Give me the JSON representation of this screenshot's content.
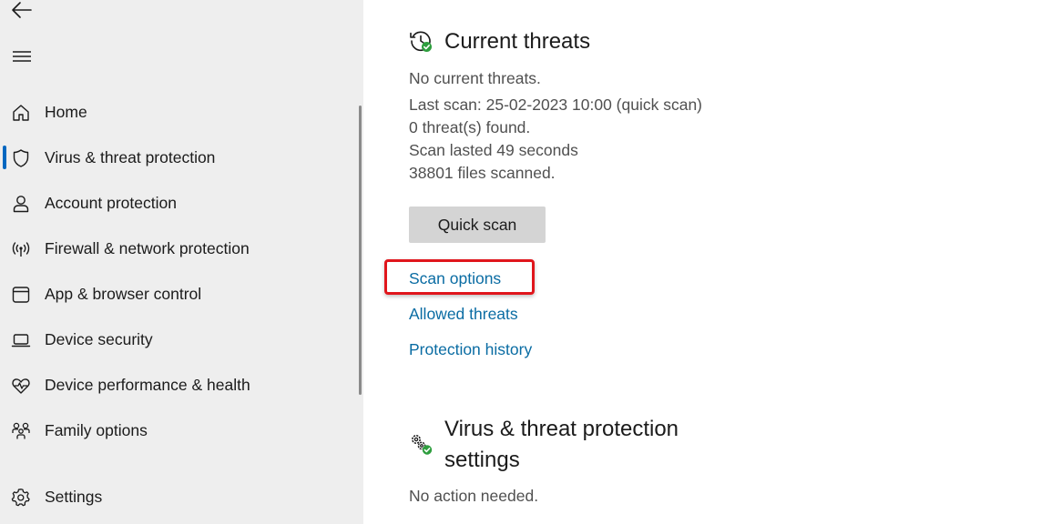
{
  "sidebar": {
    "items": [
      {
        "label": "Home",
        "icon": "home-icon"
      },
      {
        "label": "Virus & threat protection",
        "icon": "shield-icon",
        "active": true
      },
      {
        "label": "Account protection",
        "icon": "person-icon"
      },
      {
        "label": "Firewall & network protection",
        "icon": "antenna-icon"
      },
      {
        "label": "App & browser control",
        "icon": "browser-window-icon"
      },
      {
        "label": "Device security",
        "icon": "laptop-icon"
      },
      {
        "label": "Device performance & health",
        "icon": "heart-pulse-icon"
      },
      {
        "label": "Family options",
        "icon": "family-icon"
      },
      {
        "label": "Settings",
        "icon": "gear-icon"
      }
    ]
  },
  "current_threats": {
    "title": "Current threats",
    "status": "No current threats.",
    "last_scan": "Last scan: 25-02-2023 10:00 (quick scan)",
    "threats_found": "0 threat(s) found.",
    "duration": "Scan lasted 49 seconds",
    "files_scanned": "38801 files scanned.",
    "quick_scan_label": "Quick scan",
    "links": {
      "scan_options": "Scan options",
      "allowed_threats": "Allowed threats",
      "protection_history": "Protection history"
    }
  },
  "settings_section": {
    "title_line1": "Virus & threat protection",
    "title_line2": "settings",
    "status": "No action needed."
  },
  "colors": {
    "accent": "#0067c0",
    "link": "#0a6ca3",
    "highlight": "#e0161c",
    "ok_green": "#2e9e3e"
  }
}
